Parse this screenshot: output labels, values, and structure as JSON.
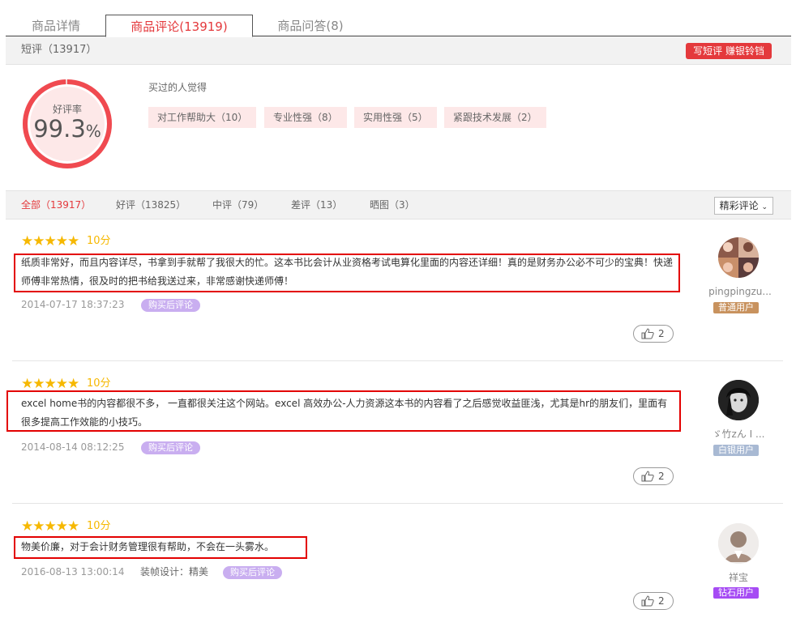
{
  "tabs": [
    {
      "label": "商品详情"
    },
    {
      "label": "商品评论(13919)"
    },
    {
      "label": "商品问答(8)"
    }
  ],
  "short_review": {
    "label": "短评（13917）",
    "write_button": "写短评 赚银铃铛"
  },
  "rating": {
    "label": "好评率",
    "value": "99.3",
    "unit": "%",
    "fraction": 0.993,
    "accent": "#f04a50"
  },
  "buyers_think": {
    "label": "买过的人觉得",
    "tags": [
      "对工作帮助大（10）",
      "专业性强（8）",
      "实用性强（5）",
      "紧跟技术发展（2）"
    ]
  },
  "filters": {
    "items": [
      "全部（13917）",
      "好评（13825）",
      "中评（79）",
      "差评（13）",
      "晒图（3）"
    ],
    "active_index": 0,
    "sort_label": "精彩评论"
  },
  "reviews": [
    {
      "stars": 5,
      "score": "10分",
      "lines": [
        "纸质非常好，而且内容详尽，书拿到手就帮了我很大的忙。这本书比会计从业资格考试电算化里面的内容还详细！真的是财务办公必不可少的宝典！快递",
        "师傅非常热情，很及时的把书给我送过来，非常感谢快递师傅！"
      ],
      "date": "2014-07-17 18:37:23",
      "extra": "",
      "badge": "购买后评论",
      "user": {
        "name": "pingpingzu...",
        "level": "普通用户",
        "level_color": "#c8925e",
        "avatar": "collage-avatar-icon"
      },
      "likes": "2"
    },
    {
      "stars": 5,
      "score": "10分",
      "lines": [
        "excel home书的内容都很不多， 一直都很关注这个网站。excel 高效办公-人力资源这本书的内容看了之后感觉收益匪浅，尤其是hr的朋友们，里面有",
        "很多提高工作效能的小技巧。"
      ],
      "date": "2014-08-14 08:12:25",
      "extra": "",
      "badge": "购买后评论",
      "user": {
        "name": "ゞ竹zん I ...",
        "level": "白银用户",
        "level_color": "#a8b9d3",
        "avatar": "dark-portrait-avatar-icon"
      },
      "likes": "2"
    },
    {
      "stars": 5,
      "score": "10分",
      "lines": [
        "物美价廉，对于会计财务管理很有帮助，不会在一头雾水。"
      ],
      "date": "2016-08-13 13:00:14",
      "extra": "装帧设计：精美",
      "badge": "购买后评论",
      "user": {
        "name": "祥宝",
        "level": "钻石用户",
        "level_color": "#a64bf4",
        "avatar": "default-user-avatar-icon"
      },
      "likes": "2"
    }
  ]
}
